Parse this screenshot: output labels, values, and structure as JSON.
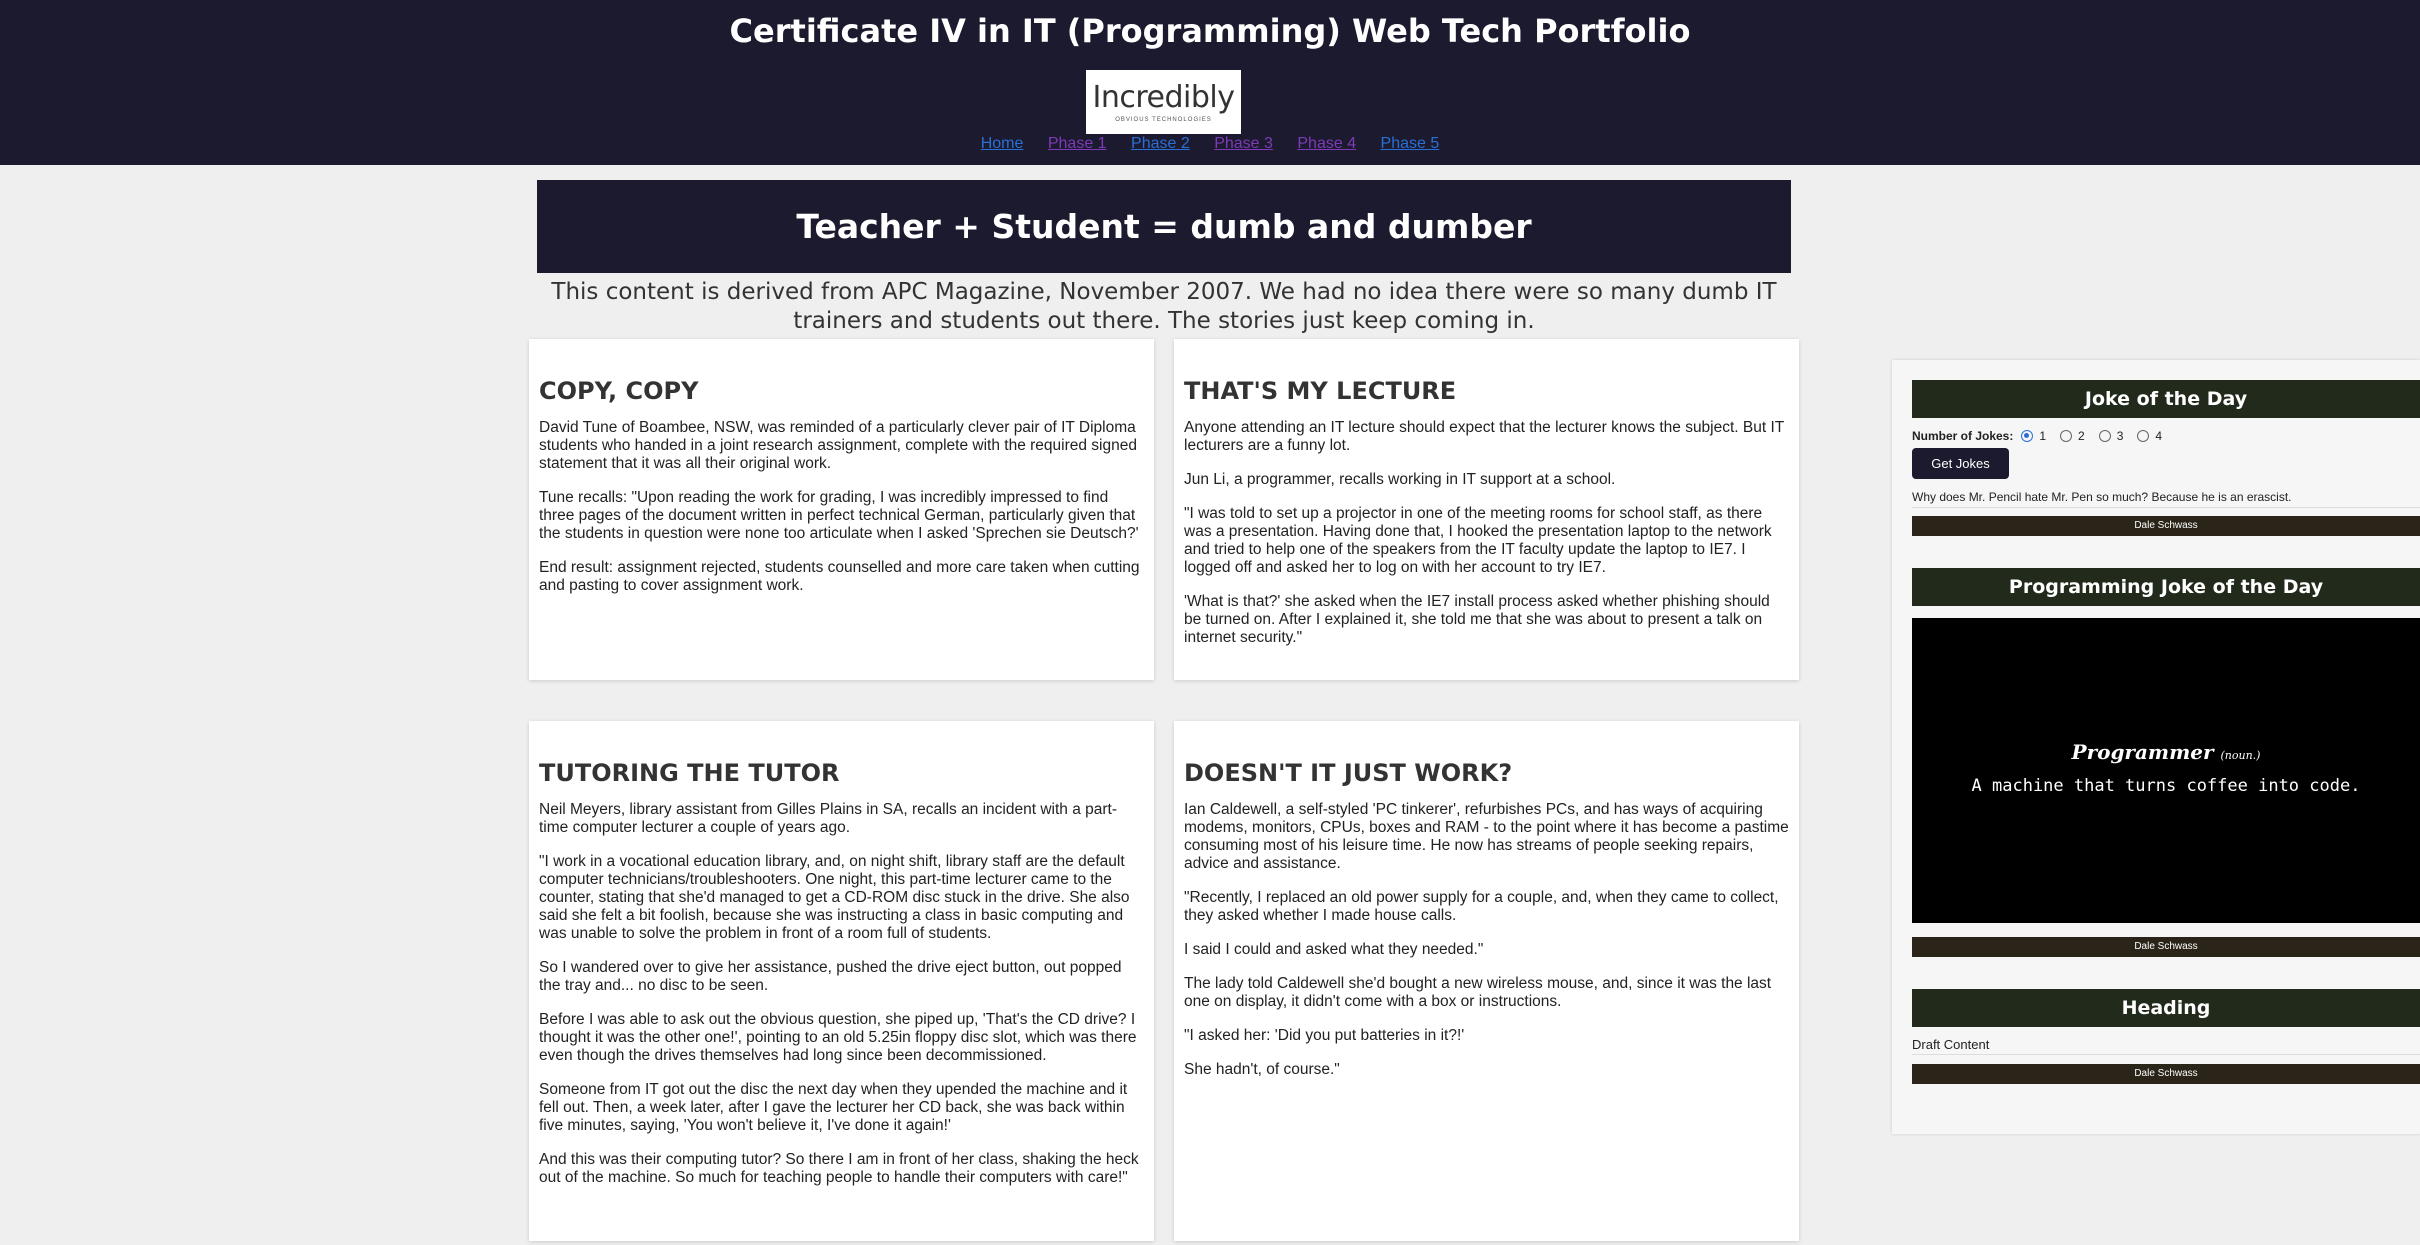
{
  "header": {
    "title": "Certificate IV in IT (Programming) Web Tech Portfolio",
    "logo_word": "Incredibly",
    "logo_tagline": "OBVIOUS TECHNOLOGIES",
    "nav": [
      "Home",
      "Phase 1",
      "Phase 2",
      "Phase 3",
      "Phase 4",
      "Phase 5"
    ]
  },
  "hero": {
    "title": "Teacher + Student = dumb and dumber",
    "intro": "This content is derived from APC Magazine, November 2007. We had no idea there were so many dumb IT trainers and students out there. The stories just keep coming in."
  },
  "cards": [
    {
      "heading": "COPY, COPY",
      "paragraphs": [
        "David Tune of Boambee, NSW, was reminded of a particularly clever pair of IT Diploma students who handed in a joint research assignment, complete with the required signed statement that it was all their original work.",
        "Tune recalls: \"Upon reading the work for grading, I was incredibly impressed to find three pages of the document written in perfect technical German, particularly given that the students in question were none too articulate when I asked 'Sprechen sie Deutsch?'",
        "End result: assignment rejected, students counselled and more care taken when cutting and pasting to cover assignment work."
      ]
    },
    {
      "heading": "THAT'S MY LECTURE",
      "paragraphs": [
        "Anyone attending an IT lecture should expect that the lecturer knows the subject. But IT lecturers are a funny lot.",
        "Jun Li, a programmer, recalls working in IT support at a school.",
        "\"I was told to set up a projector in one of the meeting rooms for school staff, as there was a presentation. Having done that, I hooked the presentation laptop to the network and tried to help one of the speakers from the IT faculty update the laptop to IE7. I logged off and asked her to log on with her account to try IE7.",
        "'What is that?' she asked when the IE7 install process asked whether phishing should be turned on. After I explained it, she told me that she was about to present a talk on internet security.\""
      ]
    },
    {
      "heading": "TUTORING THE TUTOR",
      "paragraphs": [
        "Neil Meyers, library assistant from Gilles Plains in SA, recalls an incident with a part-time computer lecturer a couple of years ago.",
        "\"I work in a vocational education library, and, on night shift, library staff are the default computer technicians/troubleshooters. One night, this part-time lecturer came to the counter, stating that she'd managed to get a CD-ROM disc stuck in the drive. She also said she felt a bit foolish, because she was instructing a class in basic computing and was unable to solve the problem in front of a room full of students.",
        "So I wandered over to give her assistance, pushed the drive eject button, out popped the tray and... no disc to be seen.",
        "Before I was able to ask out the obvious question, she piped up, 'That's the CD drive? I thought it was the other one!', pointing to an old 5.25in floppy disc slot, which was there even though the drives themselves had long since been decommissioned.",
        "Someone from IT got out the disc the next day when they upended the machine and it fell out. Then, a week later, after I gave the lecturer her CD back, she was back within five minutes, saying, 'You won't believe it, I've done it again!'",
        "And this was their computing tutor? So there I am in front of her class, shaking the heck out of the machine. So much for teaching people to handle their computers with care!\""
      ]
    },
    {
      "heading": "DOESN'T IT JUST WORK?",
      "paragraphs": [
        "Ian Caldewell, a self-styled 'PC tinkerer', refurbishes PCs, and has ways of acquiring modems, monitors, CPUs, boxes and RAM - to the point where it has become a pastime consuming most of his leisure time. He now has streams of people seeking repairs, advice and assistance.",
        "\"Recently, I replaced an old power supply for a couple, and, when they came to collect, they asked whether I made house calls.",
        "I said I could and asked what they needed.\"",
        "The lady told Caldewell she'd bought a new wireless mouse, and, since it was the last one on display, it didn't come with a box or instructions.",
        "\"I asked her: 'Did you put batteries in it?!'",
        "She hadn't, of course.\""
      ]
    }
  ],
  "sidebar": {
    "joke_widget": {
      "title": "Joke of the Day",
      "count_label": "Number of Jokes:",
      "options": [
        "1",
        "2",
        "3",
        "4"
      ],
      "selected": "1",
      "button": "Get Jokes",
      "joke": "Why does Mr. Pencil hate Mr. Pen so much? Because he is an erascist.",
      "author": "Dale Schwass"
    },
    "prog_widget": {
      "title": "Programming Joke of the Day",
      "term": "Programmer",
      "pos": "(noun.)",
      "definition": "A machine that turns coffee into code.",
      "author": "Dale Schwass"
    },
    "draft_widget": {
      "title": "Heading",
      "content": "Draft Content",
      "author": "Dale Schwass"
    }
  }
}
